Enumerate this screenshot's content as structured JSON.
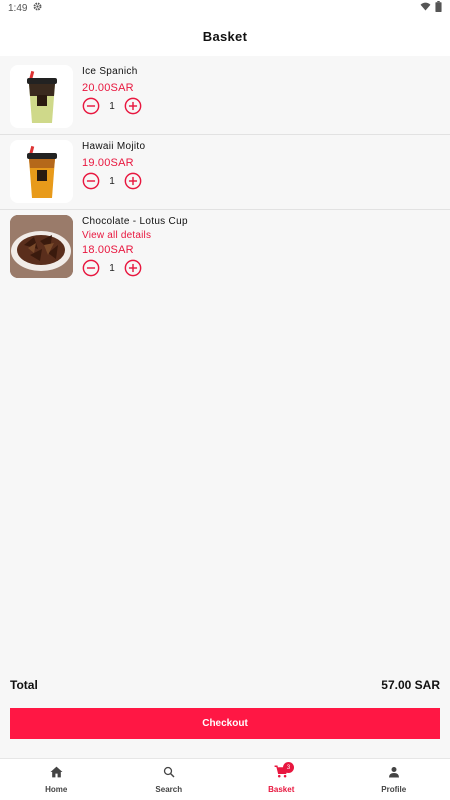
{
  "status_bar": {
    "time": "1:49"
  },
  "header": {
    "title": "Basket"
  },
  "items": [
    {
      "name": "Ice Spanich",
      "price": "20.00SAR",
      "quantity": "1"
    },
    {
      "name": "Hawaii Mojito",
      "price": "19.00SAR",
      "quantity": "1"
    },
    {
      "name": "Chocolate - Lotus Cup",
      "details_link": "View all details",
      "price": "18.00SAR",
      "quantity": "1"
    }
  ],
  "summary": {
    "total_label": "Total",
    "total_value": "57.00 SAR"
  },
  "checkout": {
    "label": "Checkout"
  },
  "nav": {
    "home": "Home",
    "search": "Search",
    "basket": "Basket",
    "basket_badge": "3",
    "profile": "Profile"
  },
  "colors": {
    "accent": "#e8173f",
    "checkout_bg": "#ff1744"
  },
  "icons": [
    "settings-icon",
    "wifi-icon",
    "battery-icon",
    "minus-circle-icon",
    "plus-circle-icon",
    "home-icon",
    "search-icon",
    "cart-icon",
    "person-icon"
  ]
}
